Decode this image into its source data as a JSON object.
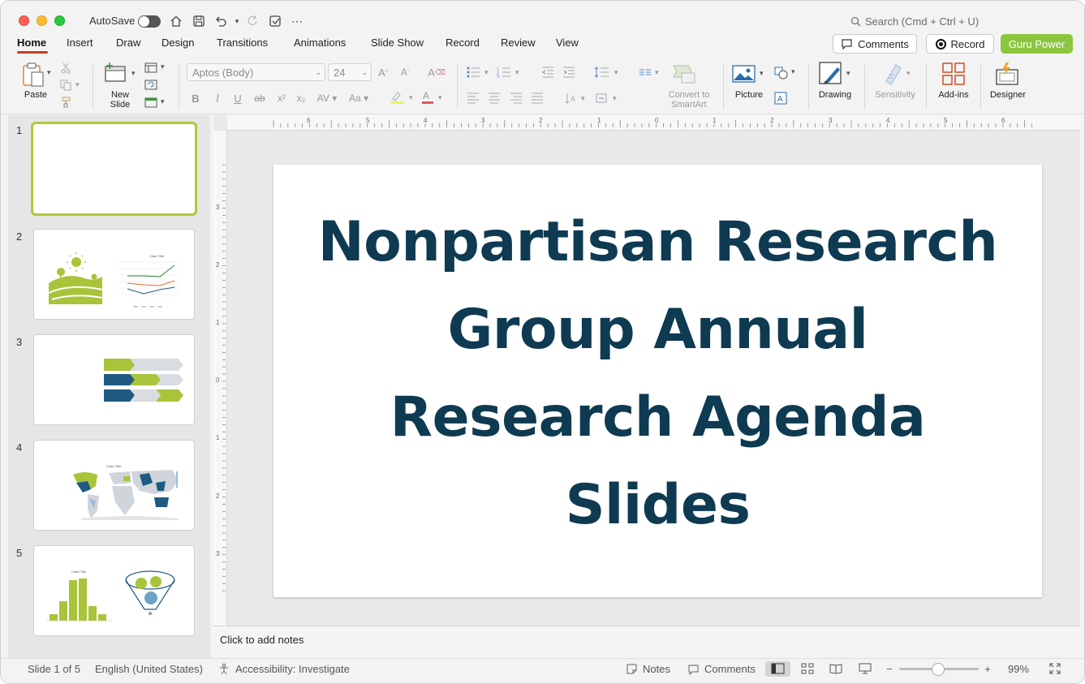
{
  "titlebar": {
    "autosave_label": "AutoSave",
    "search_placeholder": "Search (Cmd + Ctrl + U)"
  },
  "tabs": [
    {
      "label": "Home",
      "active": true
    },
    {
      "label": "Insert"
    },
    {
      "label": "Draw"
    },
    {
      "label": "Design"
    },
    {
      "label": "Transitions"
    },
    {
      "label": "Animations"
    },
    {
      "label": "Slide Show"
    },
    {
      "label": "Record"
    },
    {
      "label": "Review"
    },
    {
      "label": "View"
    }
  ],
  "header_buttons": {
    "comments": "Comments",
    "record": "Record",
    "guru": "Guru Power",
    "guru_color": "#8cc63f"
  },
  "ribbon": {
    "paste": "Paste",
    "new_slide_line1": "New",
    "new_slide_line2": "Slide",
    "font_name": "Aptos (Body)",
    "font_size": "24",
    "convert_line1": "Convert to",
    "convert_line2": "SmartArt",
    "picture": "Picture",
    "drawing": "Drawing",
    "sensitivity": "Sensitivity",
    "addins": "Add-ins",
    "designer": "Designer"
  },
  "ruler": {
    "h_labels": [
      "6",
      "5",
      "4",
      "3",
      "2",
      "1",
      "0",
      "1",
      "2",
      "3",
      "4",
      "5",
      "6"
    ],
    "v_labels": [
      "3",
      "2",
      "1",
      "0",
      "1",
      "2",
      "3"
    ]
  },
  "thumbnails": [
    {
      "num": "1"
    },
    {
      "num": "2"
    },
    {
      "num": "3"
    },
    {
      "num": "4"
    },
    {
      "num": "5"
    }
  ],
  "slide": {
    "title": "Nonpartisan Research Group Annual Research Agenda Slides",
    "title_color": "#0e3a52"
  },
  "notes": {
    "placeholder": "Click to add notes"
  },
  "status": {
    "slide_info": "Slide 1 of 5",
    "language": "English (United States)",
    "accessibility": "Accessibility: Investigate",
    "notes": "Notes",
    "comments": "Comments",
    "zoom": "99%"
  }
}
